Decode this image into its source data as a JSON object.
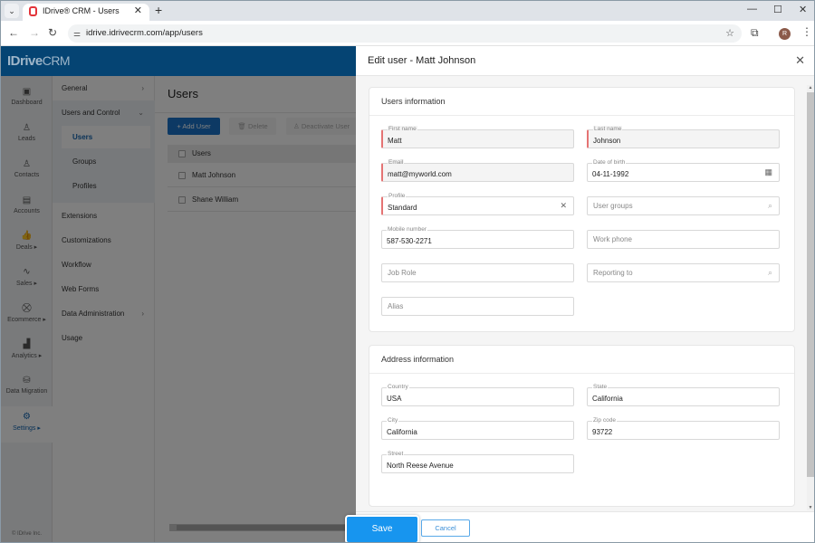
{
  "browser": {
    "tab_title": "IDrive® CRM - Users",
    "url": "idrive.idrivecrm.com/app/users",
    "profile_initial": "R"
  },
  "app": {
    "logo_brand": "IDrive",
    "logo_product": "CRM",
    "copyright": "© IDrive Inc."
  },
  "leftnav": [
    {
      "icon": "dashboard-icon",
      "glyph": "▣",
      "label": "Dashboard"
    },
    {
      "icon": "leads-icon",
      "glyph": "♙",
      "label": "Leads"
    },
    {
      "icon": "contacts-icon",
      "glyph": "♙",
      "label": "Contacts"
    },
    {
      "icon": "accounts-icon",
      "glyph": "▤",
      "label": "Accounts"
    },
    {
      "icon": "deals-icon",
      "glyph": "👍",
      "label": "Deals ▸"
    },
    {
      "icon": "sales-icon",
      "glyph": "∿",
      "label": "Sales ▸"
    },
    {
      "icon": "ecommerce-icon",
      "glyph": "⛒",
      "label": "Ecommerce ▸"
    },
    {
      "icon": "analytics-icon",
      "glyph": "▟",
      "label": "Analytics ▸"
    },
    {
      "icon": "data-migration-icon",
      "glyph": "⛁",
      "label": "Data Migration"
    },
    {
      "icon": "settings-icon",
      "glyph": "⚙",
      "label": "Settings ▸"
    }
  ],
  "subnav": {
    "general": "General",
    "users_and_control": "Users and Control",
    "sub_items": [
      "Users",
      "Groups",
      "Profiles"
    ],
    "items": [
      "Extensions",
      "Customizations",
      "Workflow",
      "Web Forms",
      "Data Administration",
      "Usage"
    ]
  },
  "main": {
    "title": "Users",
    "add_user": "+ Add User",
    "delete": "Delete",
    "deactivate": "Deactivate User",
    "column_header": "Users",
    "rows": [
      "Matt Johnson",
      "Shane William"
    ]
  },
  "modal": {
    "title": "Edit user - Matt Johnson",
    "users_section": "Users information",
    "address_section": "Address information",
    "fields": {
      "first_name": {
        "label": "First name",
        "value": "Matt"
      },
      "last_name": {
        "label": "Last name",
        "value": "Johnson"
      },
      "email": {
        "label": "Email",
        "value": "matt@myworld.com"
      },
      "dob": {
        "label": "Date of birth",
        "value": "04-11-1992"
      },
      "profile": {
        "label": "Profile",
        "value": "Standard"
      },
      "user_groups": {
        "placeholder": "User groups"
      },
      "mobile": {
        "label": "Mobile number",
        "value": "587-530-2271"
      },
      "work_phone": {
        "placeholder": "Work phone"
      },
      "job_role": {
        "placeholder": "Job Role"
      },
      "reporting_to": {
        "placeholder": "Reporting to"
      },
      "alias": {
        "placeholder": "Alias"
      },
      "country": {
        "label": "Country",
        "value": "USA"
      },
      "state": {
        "label": "State",
        "value": "California"
      },
      "city": {
        "label": "City",
        "value": "California"
      },
      "zip": {
        "label": "Zip code",
        "value": "93722"
      },
      "street": {
        "label": "Street",
        "value": "North Reese Avenue"
      }
    },
    "save": "Save",
    "cancel": "Cancel"
  },
  "colors": {
    "header_bg": "#054473",
    "primary": "#1a73c8",
    "save": "#1795ef",
    "required": "#e57373"
  }
}
